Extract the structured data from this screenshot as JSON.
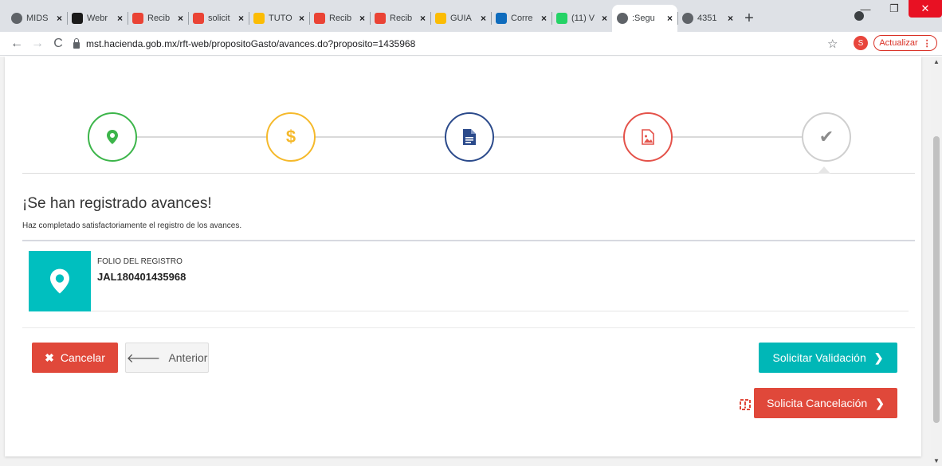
{
  "browser": {
    "tabs": [
      {
        "label": "MIDS",
        "icon": "globe-icon",
        "color": "#5f6368"
      },
      {
        "label": "Webr",
        "icon": "webex-icon",
        "color": "#1a1a1a"
      },
      {
        "label": "Recib",
        "icon": "gmail-icon",
        "color": "#ea4335"
      },
      {
        "label": "solicit",
        "icon": "gmail-icon",
        "color": "#ea4335"
      },
      {
        "label": "TUTO",
        "icon": "drive-icon",
        "color": "#fbbc04"
      },
      {
        "label": "Recib",
        "icon": "gmail-icon",
        "color": "#ea4335"
      },
      {
        "label": "Recib",
        "icon": "gmail-icon",
        "color": "#ea4335"
      },
      {
        "label": "GUIA",
        "icon": "drive-icon",
        "color": "#fbbc04"
      },
      {
        "label": "Corre",
        "icon": "outlook-icon",
        "color": "#0f6cbd"
      },
      {
        "label": "(11) V",
        "icon": "whatsapp-icon",
        "color": "#25d366"
      },
      {
        "label": ":Segu",
        "icon": "globe-icon",
        "color": "#5f6368",
        "active": true
      },
      {
        "label": "4351",
        "icon": "globe-icon",
        "color": "#5f6368"
      }
    ],
    "new_tab": "+",
    "url": "mst.hacienda.gob.mx/rft-web/propositoGasto/avances.do?proposito=1435968",
    "profile_initial": "S",
    "update_label": "Actualizar"
  },
  "steps": [
    {
      "icon": "map-marker-icon",
      "color": "#3cb54a"
    },
    {
      "icon": "dollar-icon",
      "symbol": "$",
      "color": "#f5b92b"
    },
    {
      "icon": "document-icon",
      "color": "#2b4a8b"
    },
    {
      "icon": "image-file-icon",
      "color": "#e4524a"
    },
    {
      "icon": "checkmark-icon",
      "symbol": "✔",
      "color": "#8c8c8c"
    }
  ],
  "main": {
    "title": "¡Se han registrado avances!",
    "subtitle": "Haz completado satisfactoriamente el registro de los avances.",
    "folio_label": "FOLIO DEL REGISTRO",
    "folio_value": "JAL180401435968"
  },
  "buttons": {
    "cancel": "Cancelar",
    "previous": "Anterior",
    "request_validation": "Solicitar Validación",
    "request_cancellation": "Solicita Cancelación"
  },
  "colors": {
    "teal": "#00b7b7",
    "red": "#e0483a"
  }
}
